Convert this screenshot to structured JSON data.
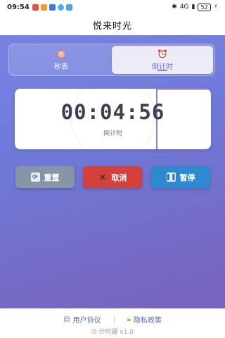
{
  "status_bar": {
    "time": "09:54",
    "network": "4G",
    "battery": "52"
  },
  "app": {
    "title": "悦来时光"
  },
  "tabs": [
    {
      "label": "秒表",
      "icon": "stopwatch-icon",
      "active": false
    },
    {
      "label": "倒计时",
      "icon": "alarm-clock-icon",
      "active": true
    }
  ],
  "timer": {
    "display": "00:04:56",
    "label": "倒计时"
  },
  "buttons": {
    "reset": {
      "label": "重置",
      "icon": "refresh-icon"
    },
    "cancel": {
      "label": "取消",
      "icon": "close-icon"
    },
    "pause": {
      "label": "暂停",
      "icon": "pause-icon"
    }
  },
  "footer": {
    "user_agreement": "用户协议",
    "privacy_policy": "隐私政策",
    "version": "计时器 v1.0"
  },
  "colors": {
    "accent": "#6c6fd6",
    "reset": "#8795a8",
    "cancel": "#d4403b",
    "pause": "#2e8ad0"
  }
}
